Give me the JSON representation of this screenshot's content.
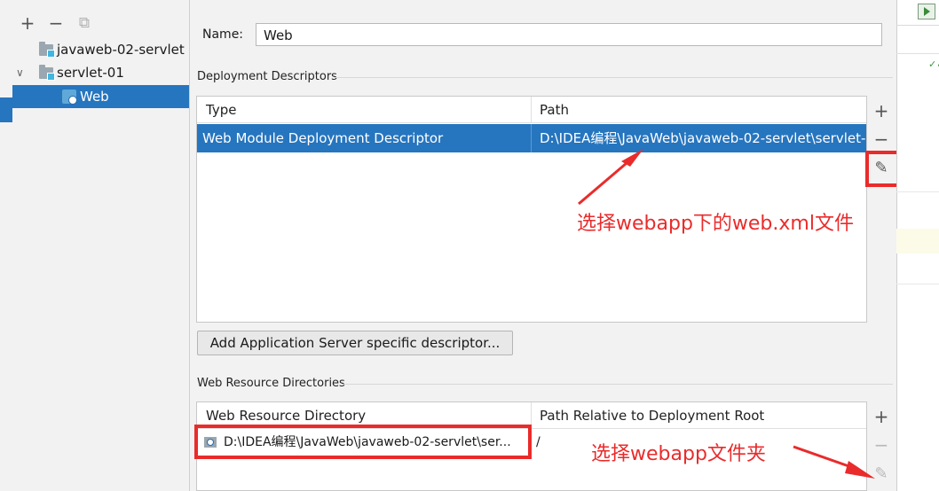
{
  "tree": {
    "toolbar": {
      "add": "+",
      "remove": "−",
      "copy": "⧉"
    },
    "items": [
      {
        "label": "javaweb-02-servlet"
      },
      {
        "label": "servlet-01"
      },
      {
        "label": "Web"
      }
    ]
  },
  "name_field": {
    "label": "Name:",
    "value": "Web"
  },
  "deployment": {
    "section_title": "Deployment Descriptors",
    "columns": [
      "Type",
      "Path"
    ],
    "rows": [
      {
        "type": "Web Module Deployment Descriptor",
        "path": "D:\\IDEA编程\\JavaWeb\\javaweb-02-servlet\\servlet-0"
      }
    ],
    "tools": {
      "add": "+",
      "remove": "−",
      "edit": "✎"
    },
    "add_server_button": "Add Application Server specific descriptor..."
  },
  "resources": {
    "section_title": "Web Resource Directories",
    "columns": [
      "Web Resource Directory",
      "Path Relative to Deployment Root"
    ],
    "rows": [
      {
        "dir": "D:\\IDEA编程\\JavaWeb\\javaweb-02-servlet\\ser...",
        "relative": "/"
      }
    ],
    "tools": {
      "add": "+",
      "remove": "−",
      "edit": "✎"
    }
  },
  "annotations": {
    "first": "选择webapp下的web.xml文件",
    "second": "选择webapp文件夹"
  },
  "colors": {
    "selection": "#2675bf",
    "annotation": "#ea2b2b"
  }
}
